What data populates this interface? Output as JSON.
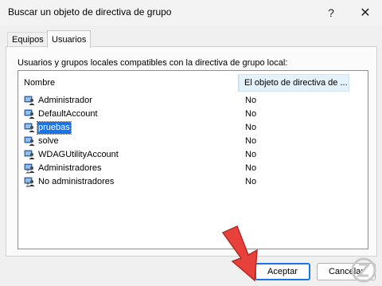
{
  "window": {
    "title": "Buscar un objeto de directiva de grupo",
    "help": "?",
    "close": "✕"
  },
  "tabs": [
    {
      "label": "Equipos",
      "selected": false
    },
    {
      "label": "Usuarios",
      "selected": true
    }
  ],
  "panel": {
    "caption": "Usuarios y grupos locales compatibles con la directiva de grupo local:"
  },
  "list": {
    "columns": [
      "Nombre",
      "El objeto de directiva de ..."
    ],
    "rows": [
      {
        "name": "Administrador",
        "value": "No",
        "icon": "user-icon"
      },
      {
        "name": "DefaultAccount",
        "value": "No",
        "icon": "user-icon"
      },
      {
        "name": "pruebas",
        "value": "No",
        "icon": "user-icon",
        "selected": true
      },
      {
        "name": "solve",
        "value": "No",
        "icon": "user-icon"
      },
      {
        "name": "WDAGUtilityAccount",
        "value": "No",
        "icon": "user-icon"
      },
      {
        "name": "Administradores",
        "value": "No",
        "icon": "group-icon"
      },
      {
        "name": "No administradores",
        "value": "No",
        "icon": "group-icon"
      }
    ]
  },
  "buttons": {
    "ok": "Aceptar",
    "cancel": "Cancelar"
  },
  "colors": {
    "accent": "#1a73e8",
    "arrow": "#e8403a"
  }
}
